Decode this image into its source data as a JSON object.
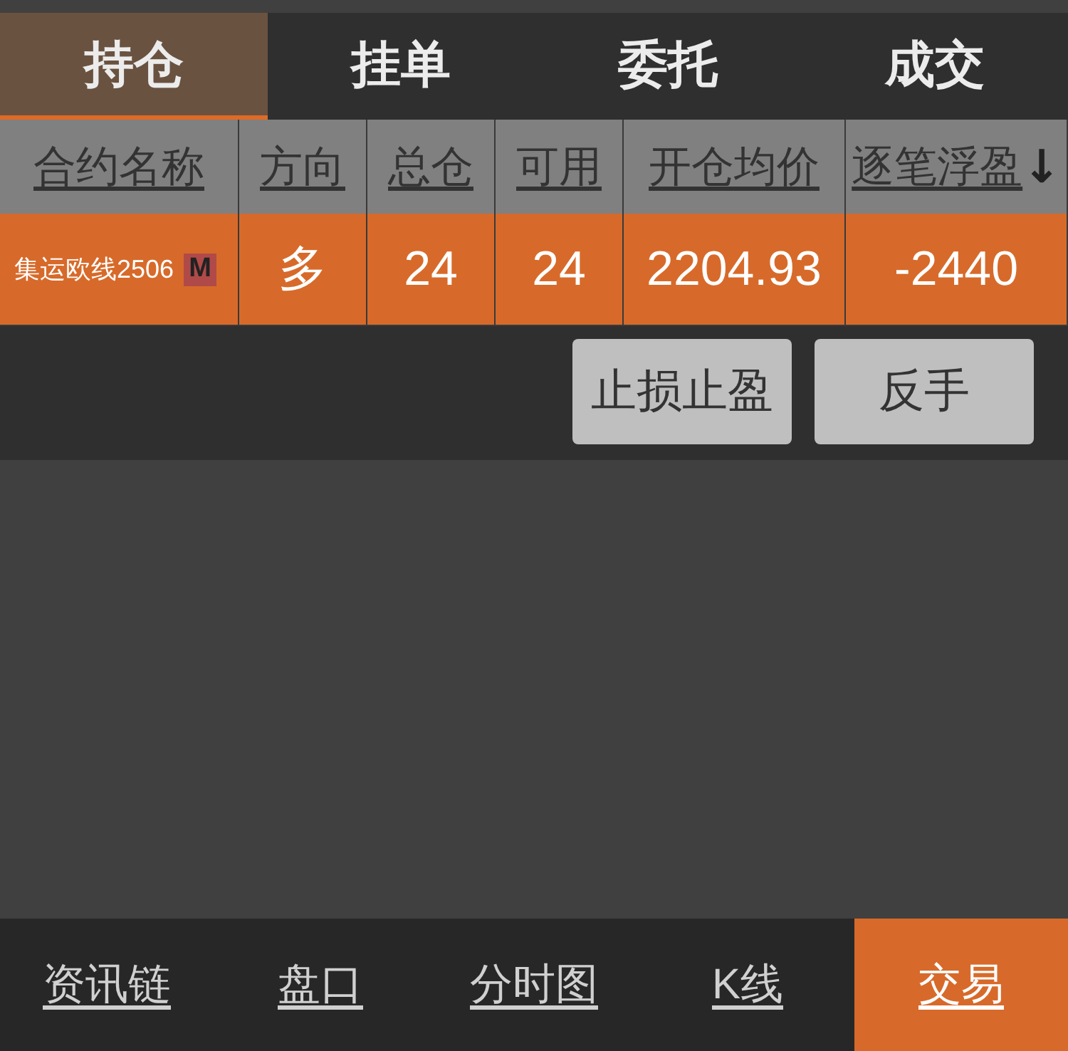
{
  "tabs": [
    {
      "label": "持仓",
      "selected": true
    },
    {
      "label": "挂单",
      "selected": false
    },
    {
      "label": "委托",
      "selected": false
    },
    {
      "label": "成交",
      "selected": false
    }
  ],
  "table": {
    "columns": [
      {
        "label": "合约名称"
      },
      {
        "label": "方向"
      },
      {
        "label": "总仓"
      },
      {
        "label": "可用"
      },
      {
        "label": "开仓均价"
      },
      {
        "label": "逐笔浮盈",
        "sort_mark": "↓"
      }
    ],
    "rows": [
      {
        "selected": true,
        "contract": "集运欧线2506",
        "tag": "M",
        "direction": "多",
        "total": "24",
        "available": "24",
        "avg_open_price": "2204.93",
        "floating_pnl": "-2440"
      }
    ]
  },
  "actions": [
    {
      "label": "止损止盈"
    },
    {
      "label": "反手"
    }
  ],
  "bottom_nav": [
    {
      "label": "资讯链",
      "selected": false
    },
    {
      "label": "盘口",
      "selected": false
    },
    {
      "label": "分时图",
      "selected": false
    },
    {
      "label": "K线",
      "selected": false
    },
    {
      "label": "交易",
      "selected": true
    }
  ]
}
